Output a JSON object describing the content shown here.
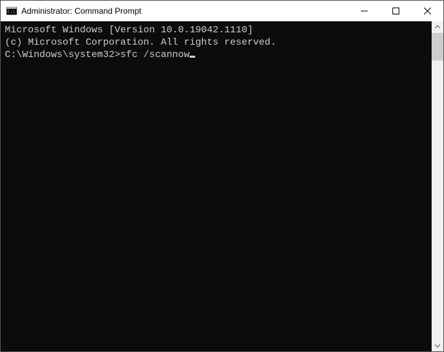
{
  "window": {
    "title": "Administrator: Command Prompt",
    "icons": {
      "app": "cmd-icon",
      "minimize": "minimize-icon",
      "maximize": "maximize-icon",
      "close": "close-icon",
      "scroll_up": "chevron-up-icon",
      "scroll_down": "chevron-down-icon"
    }
  },
  "terminal": {
    "lines": [
      "Microsoft Windows [Version 10.0.19042.1110]",
      "(c) Microsoft Corporation. All rights reserved.",
      ""
    ],
    "prompt": "C:\\Windows\\system32>",
    "input": "sfc /scannow"
  },
  "colors": {
    "terminal_bg": "#0c0c0c",
    "terminal_fg": "#cccccc",
    "titlebar_bg": "#ffffff"
  }
}
